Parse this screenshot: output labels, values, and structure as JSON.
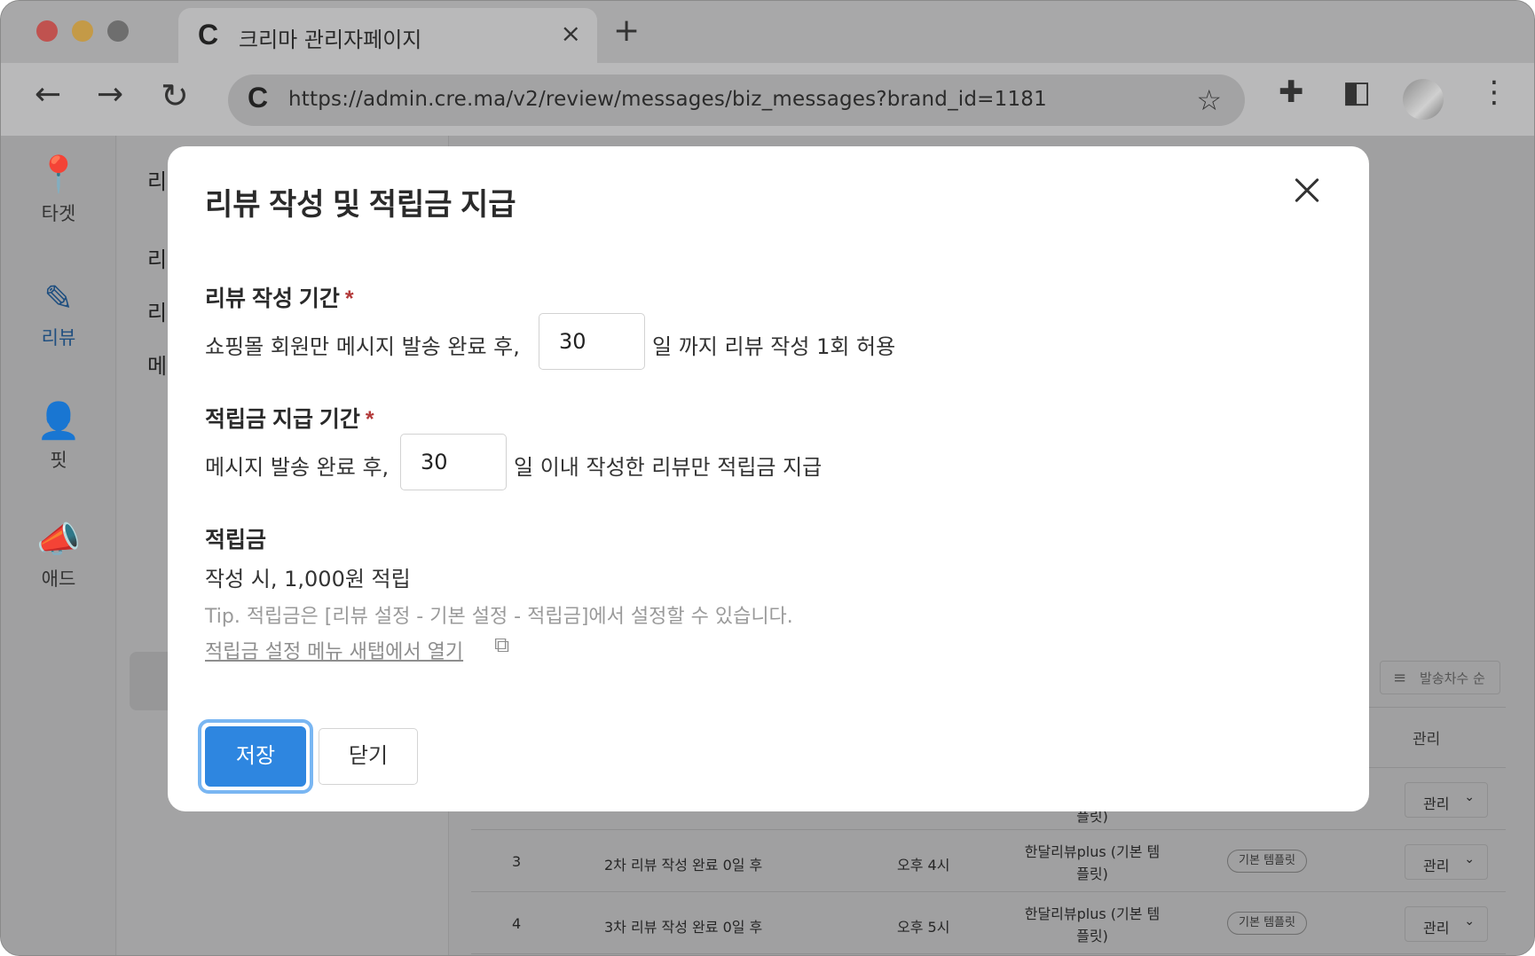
{
  "browser": {
    "tab_title": "크리마 관리자페이지",
    "tab_favicon": "C",
    "url": "https://admin.cre.ma/v2/review/messages/biz_messages?brand_id=1181",
    "omnibox_icon": "C",
    "icons": {
      "close": "×",
      "new_tab": "+",
      "back": "←",
      "forward": "→",
      "reload": "↻",
      "star": "☆",
      "extensions": "✚",
      "side_panel": "◧",
      "menu": "⋮"
    }
  },
  "sidebar": {
    "items": [
      {
        "label": "타겟",
        "icon": "📍"
      },
      {
        "label": "리뷰",
        "icon": "✎"
      },
      {
        "label": "핏",
        "icon": "👤"
      },
      {
        "label": "애드",
        "icon": "📣"
      }
    ]
  },
  "subnav": {
    "items": [
      "리",
      "리",
      "리",
      "메"
    ]
  },
  "table": {
    "sort_label": "발송차수 순",
    "sort_icon": "≡",
    "manage_header": "관리",
    "partial_row_text": "플릿)",
    "rows": [
      {
        "num": "",
        "condition": "",
        "time": "",
        "template": "플릿)",
        "badge": "",
        "manage": "관리"
      },
      {
        "num": "3",
        "condition": "2차 리뷰 작성 완료 0일 후",
        "time": "오후 4시",
        "template": "한달리뷰plus (기본 템플릿)",
        "badge": "기본 템플릿",
        "manage": "관리"
      },
      {
        "num": "4",
        "condition": "3차 리뷰 작성 완료 0일 후",
        "time": "오후 5시",
        "template": "한달리뷰plus (기본 템플릿)",
        "badge": "기본 템플릿",
        "manage": "관리"
      }
    ],
    "chevron": "⌄"
  },
  "modal": {
    "title": "리뷰 작성 및 적립금 지급",
    "review_period": {
      "label": "리뷰 작성 기간",
      "required_mark": "*",
      "prefix": "쇼핑몰 회원만 메시지 발송 완료 후,",
      "value": "30",
      "suffix": "일 까지 리뷰 작성 1회 허용"
    },
    "reward_period": {
      "label": "적립금 지급 기간",
      "required_mark": "*",
      "prefix": "메시지 발송 완료 후,",
      "value": "30",
      "suffix": "일 이내 작성한 리뷰만 적립금 지급"
    },
    "reward": {
      "label": "적립금",
      "text": "작성 시, 1,000원 적립",
      "tip": "Tip. 적립금은 [리뷰 설정 - 기본 설정 - 적립금]에서 설정할 수 있습니다.",
      "link": "적립금 설정 메뉴 새탭에서 열기",
      "link_icon": "⧉"
    },
    "save_label": "저장",
    "close_label": "닫기"
  }
}
